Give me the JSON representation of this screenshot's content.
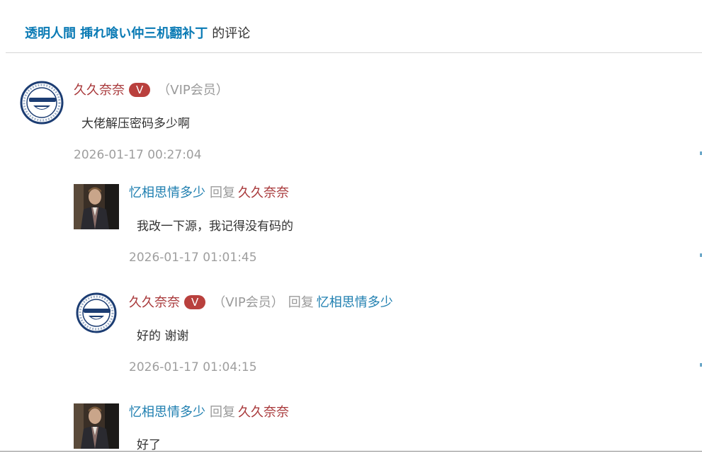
{
  "header": {
    "post_title": "透明人間 挿れ喰い仲三机翻补丁",
    "suffix": "的评论"
  },
  "comments": [
    {
      "author": "久久奈奈",
      "vip_badge": "V",
      "vip_note": "（VIP会员）",
      "text": "大佬解压密码多少啊",
      "time": "2026-01-17 00:27:04",
      "avatar": "laughing-man-logo"
    },
    {
      "author": "忆相思情多少",
      "reply_word": "回复",
      "reply_to": "久久奈奈",
      "text": "我改一下源，我记得没有码的",
      "time": "2026-01-17 01:01:45",
      "avatar": "man-in-suit-photo"
    },
    {
      "author": "久久奈奈",
      "vip_badge": "V",
      "vip_note": "（VIP会员）",
      "reply_word": "回复",
      "reply_to": "忆相思情多少",
      "text": "好的 谢谢",
      "time": "2026-01-17 01:04:15",
      "avatar": "laughing-man-logo"
    },
    {
      "author": "忆相思情多少",
      "reply_word": "回复",
      "reply_to": "久久奈奈",
      "text": "好了",
      "avatar": "man-in-suit-photo"
    }
  ],
  "colors": {
    "link_blue": "#0b7bb5",
    "author_red": "#a8383a",
    "vip_badge": "#b9403d",
    "muted_gray": "#9e9e9e"
  }
}
